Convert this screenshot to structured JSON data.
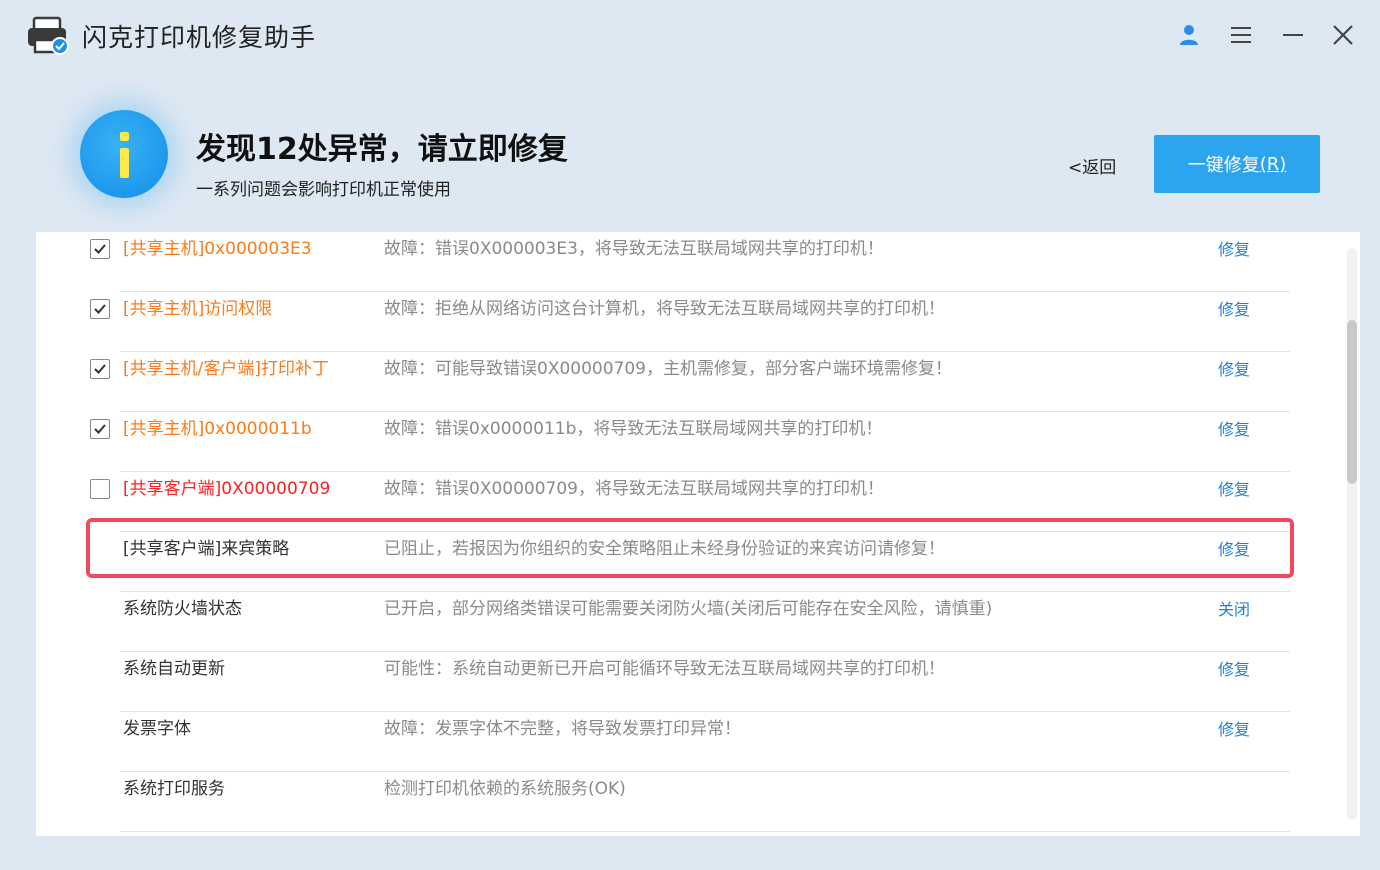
{
  "app": {
    "title": "闪克打印机修复助手",
    "icons": {
      "user": "user-icon",
      "menu": "menu-icon",
      "minimize": "minimize-icon",
      "close": "close-icon"
    },
    "accent_color": "#2da4ee"
  },
  "header": {
    "headline": "发现12处异常，请立即修复",
    "subline": "一系列问题会影响打印机正常使用",
    "back_label": "<返回",
    "fix_all_label": "一键修复",
    "fix_all_shortcut": "(R)"
  },
  "items": [
    {
      "name": "[共享主机]0x000003E3",
      "desc": "故障：错误0X000003E3，将导致无法互联局域网共享的打印机！",
      "action": "修复",
      "checkbox": true,
      "checked": true,
      "name_color": "orange"
    },
    {
      "name": "[共享主机]访问权限",
      "desc": "故障：拒绝从网络访问这台计算机，将导致无法互联局域网共享的打印机！",
      "action": "修复",
      "checkbox": true,
      "checked": true,
      "name_color": "orange"
    },
    {
      "name": "[共享主机/客户端]打印补丁",
      "desc": "故障：可能导致错误0X00000709，主机需修复，部分客户端环境需修复！",
      "action": "修复",
      "checkbox": true,
      "checked": true,
      "name_color": "orange"
    },
    {
      "name": "[共享主机]0x0000011b",
      "desc": "故障：错误0x0000011b，将导致无法互联局域网共享的打印机！",
      "action": "修复",
      "checkbox": true,
      "checked": true,
      "name_color": "orange"
    },
    {
      "name": "[共享客户端]0X00000709",
      "desc": "故障：错误0X00000709，将导致无法互联局域网共享的打印机！",
      "action": "修复",
      "checkbox": true,
      "checked": false,
      "name_color": "red"
    },
    {
      "name": "[共享客户端]来宾策略",
      "desc": "已阻止，若报因为你组织的安全策略阻止未经身份验证的来宾访问请修复！",
      "action": "修复",
      "checkbox": false,
      "checked": false,
      "name_color": "black",
      "highlighted": true
    },
    {
      "name": "系统防火墙状态",
      "desc": "已开启，部分网络类错误可能需要关闭防火墙(关闭后可能存在安全风险，请慎重)",
      "action": "关闭",
      "checkbox": false,
      "checked": false,
      "name_color": "black"
    },
    {
      "name": "系统自动更新",
      "desc": "可能性：系统自动更新已开启可能循环导致无法互联局域网共享的打印机！",
      "action": "修复",
      "checkbox": false,
      "checked": false,
      "name_color": "black"
    },
    {
      "name": "发票字体",
      "desc": "故障：发票字体不完整，将导致发票打印异常！",
      "action": "修复",
      "checkbox": false,
      "checked": false,
      "name_color": "black"
    },
    {
      "name": "系统打印服务",
      "desc": "检测打印机依赖的系统服务(OK)",
      "action": "",
      "checkbox": false,
      "checked": false,
      "name_color": "black"
    }
  ]
}
